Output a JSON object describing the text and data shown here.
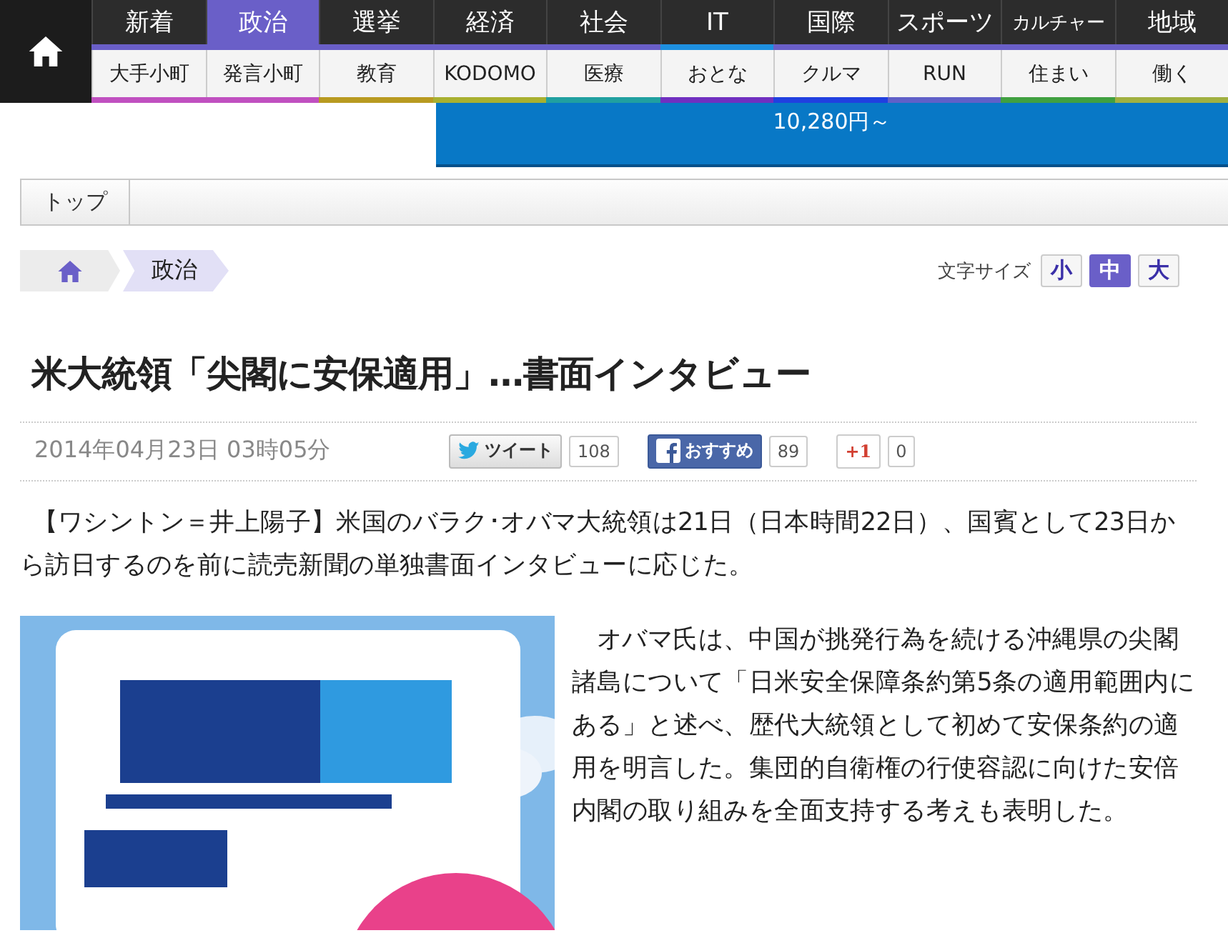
{
  "nav": {
    "top": [
      {
        "label": "新着",
        "selected": false,
        "color": "#6a5fc8"
      },
      {
        "label": "政治",
        "selected": true,
        "color": "#6a5fc8"
      },
      {
        "label": "選挙",
        "selected": false,
        "color": "#6a5fc8"
      },
      {
        "label": "経済",
        "selected": false,
        "color": "#6a5fc8"
      },
      {
        "label": "社会",
        "selected": false,
        "color": "#6a5fc8"
      },
      {
        "label": "IT",
        "selected": false,
        "color": "#1e90e0"
      },
      {
        "label": "国際",
        "selected": false,
        "color": "#6a5fc8"
      },
      {
        "label": "スポーツ",
        "selected": false,
        "color": "#6a5fc8"
      },
      {
        "label": "カルチャー",
        "selected": false,
        "color": "#6a5fc8"
      },
      {
        "label": "地域",
        "selected": false,
        "color": "#6a5fc8"
      }
    ],
    "sub": [
      {
        "label": "大手小町",
        "color": "#c050c0"
      },
      {
        "label": "発言小町",
        "color": "#c050c0"
      },
      {
        "label": "教育",
        "color": "#b89a20"
      },
      {
        "label": "KODOMO",
        "color": "#a8b030"
      },
      {
        "label": "医療",
        "color": "#20a0a0"
      },
      {
        "label": "おとな",
        "color": "#7030c0"
      },
      {
        "label": "クルマ",
        "color": "#2040e0"
      },
      {
        "label": "RUN",
        "color": "#6060c8"
      },
      {
        "label": "住まい",
        "color": "#40a040"
      },
      {
        "label": "働く",
        "color": "#a0b040"
      }
    ]
  },
  "banner": {
    "price": "10,280円～"
  },
  "toolbar": {
    "tabs": [
      "トップ"
    ]
  },
  "breadcrumb": {
    "items": [
      "政治"
    ]
  },
  "font_size": {
    "label": "文字サイズ",
    "options": [
      {
        "label": "小",
        "selected": false
      },
      {
        "label": "中",
        "selected": true
      },
      {
        "label": "大",
        "selected": false
      }
    ]
  },
  "article": {
    "title": "米大統領「尖閣に安保適用」…書面インタビュー",
    "date": "2014年04月23日 03時05分",
    "social": [
      {
        "kind": "twitter",
        "label": "ツイート",
        "count": "108"
      },
      {
        "kind": "facebook",
        "label": "おすすめ",
        "count": "89"
      },
      {
        "kind": "gplus",
        "label": "+1",
        "count": "0"
      }
    ],
    "lead": "【ワシントン＝井上陽子】米国のバラク･オバマ大統領は21日（日本時間22日）、国賓として23日から訪日するのを前に読売新聞の単独書面インタビューに応じた。",
    "body": "オバマ氏は、中国が挑発行為を続ける沖縄県の尖閣諸島について「日米安全保障条約第5条の適用範囲内にある」と述べ、歴代大統領として初めて安保条約の適用を明言した。集団的自衛権の行使容認に向けた安倍内閣の取り組みを全面支持する考えも表明した。"
  }
}
